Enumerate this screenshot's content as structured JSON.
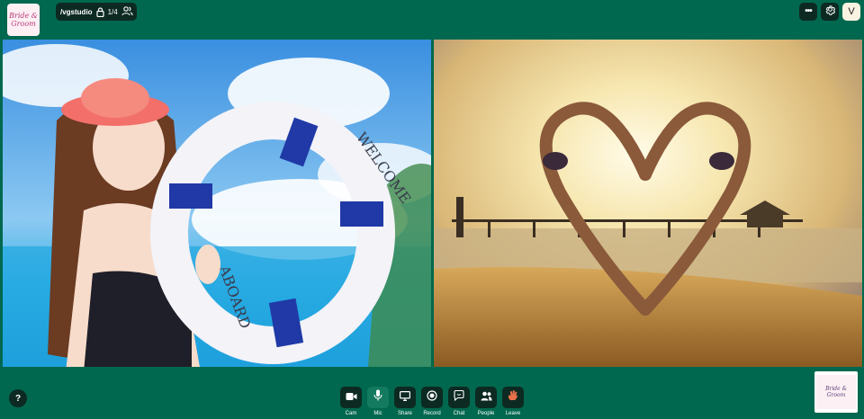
{
  "header": {
    "logo_text": "Bride & Groom",
    "room_name": "/vgstudio",
    "participant_count": "1/4",
    "avatar_initial": "V"
  },
  "tiles": {
    "left": {
      "lifebuoy_text_top": "WELCOME",
      "lifebuoy_text_bottom": "ABOARD"
    },
    "right": {}
  },
  "controls": {
    "cam_label": "Cam",
    "mic_label": "Mic",
    "share_label": "Share",
    "record_label": "Record",
    "chat_label": "Chat",
    "people_label": "People",
    "leave_label": "Leave"
  },
  "help": {
    "label": "?"
  },
  "self_view": {
    "logo_text": "Bride & Groom"
  },
  "colors": {
    "background": "#00684e",
    "control_bg": "#0d2a22",
    "mic_active": "#137a5f",
    "leave_icon": "#e8714a"
  }
}
